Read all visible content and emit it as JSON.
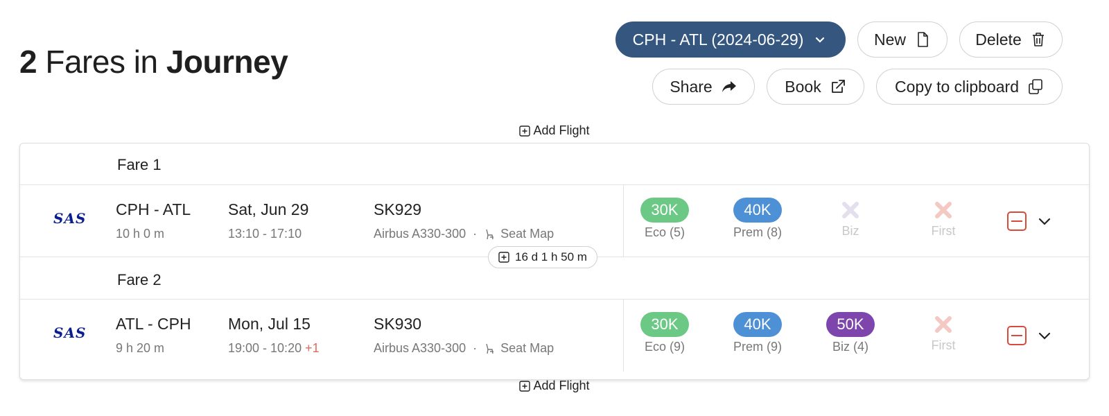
{
  "header": {
    "count": "2",
    "middle": " Fares in ",
    "word": "Journey"
  },
  "toolbar": {
    "journey_select": "CPH - ATL (2024-06-29)",
    "new_label": "New",
    "delete_label": "Delete",
    "share_label": "Share",
    "book_label": "Book",
    "copy_label": "Copy to clipboard"
  },
  "add_flight_label": "Add Flight",
  "layover": "16 d 1 h 50 m",
  "seat_map_label": "Seat Map",
  "colors": {
    "primary": "#35577f",
    "eco": "#6cc985",
    "prem": "#4e90d6",
    "biz": "#7e46ad",
    "unavailable": "#f3c6c0",
    "unavailable_biz": "#e6e2ec",
    "remove": "#d64b3a",
    "airline": "#0a1f8f"
  },
  "fares": [
    {
      "label": "Fare 1",
      "airline": "SAS",
      "route": "CPH - ATL",
      "duration": "10 h 0 m",
      "date": "Sat, Jun 29",
      "times": "13:10 - 17:10",
      "day_offset": "",
      "flight_no": "SK929",
      "aircraft": "Airbus A330-300",
      "cabins": [
        {
          "label": "Eco (5)",
          "price": "30K",
          "available": true,
          "color": "green"
        },
        {
          "label": "Prem (8)",
          "price": "40K",
          "available": true,
          "color": "blue"
        },
        {
          "label": "Biz",
          "price": "",
          "available": false
        },
        {
          "label": "First",
          "price": "",
          "available": false
        }
      ]
    },
    {
      "label": "Fare 2",
      "airline": "SAS",
      "route": "ATL - CPH",
      "duration": "9 h 20 m",
      "date": "Mon, Jul 15",
      "times": "19:00 - 10:20",
      "day_offset": "+1",
      "flight_no": "SK930",
      "aircraft": "Airbus A330-300",
      "cabins": [
        {
          "label": "Eco (9)",
          "price": "30K",
          "available": true,
          "color": "green"
        },
        {
          "label": "Prem (9)",
          "price": "40K",
          "available": true,
          "color": "blue"
        },
        {
          "label": "Biz (4)",
          "price": "50K",
          "available": true,
          "color": "purple"
        },
        {
          "label": "First",
          "price": "",
          "available": false
        }
      ]
    }
  ]
}
